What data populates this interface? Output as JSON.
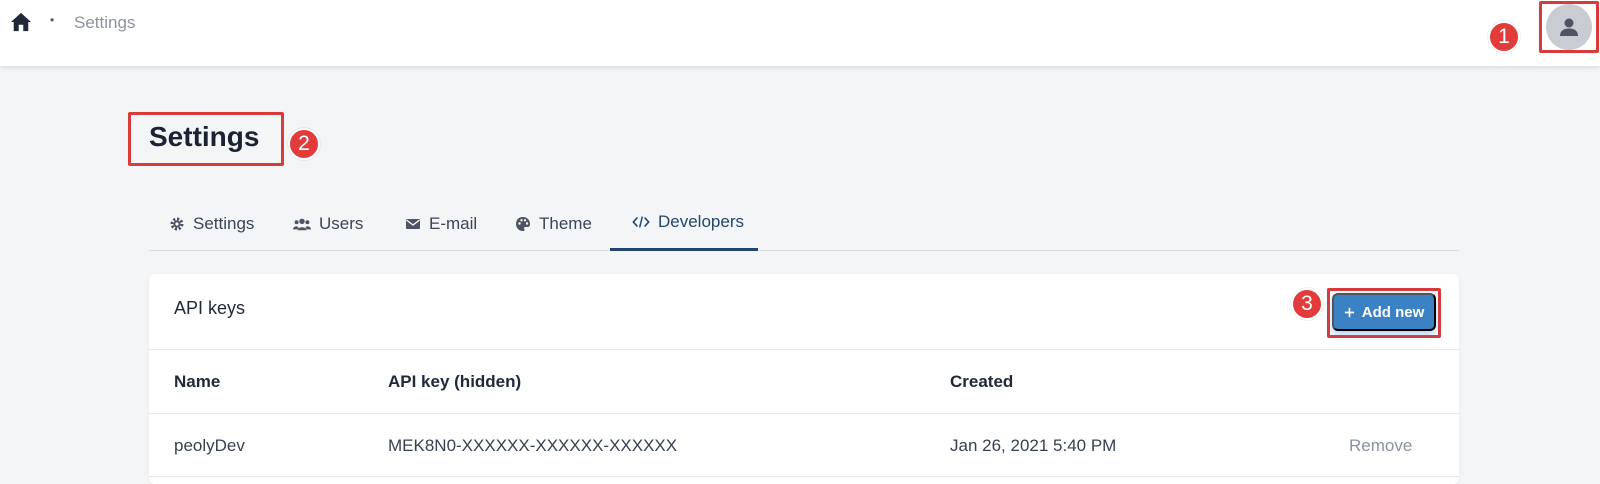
{
  "breadcrumb": {
    "separator": "•",
    "current": "Settings"
  },
  "page": {
    "title": "Settings"
  },
  "annotations": [
    "1",
    "2",
    "3"
  ],
  "tabs": [
    {
      "label": "Settings",
      "icon": "gear-icon"
    },
    {
      "label": "Users",
      "icon": "users-icon"
    },
    {
      "label": "E-mail",
      "icon": "envelope-icon"
    },
    {
      "label": "Theme",
      "icon": "palette-icon"
    },
    {
      "label": "Developers",
      "icon": "code-icon",
      "active": true
    }
  ],
  "api_keys": {
    "title": "API keys",
    "add_button": "Add new",
    "columns": [
      "Name",
      "API key (hidden)",
      "Created"
    ],
    "rows": [
      {
        "name": "peolyDev",
        "key": "MEK8N0-XXXXXX-XXXXXX-XXXXXX",
        "created": "Jan 26, 2021 5:40 PM",
        "action": "Remove"
      }
    ]
  },
  "colors": {
    "accent": "#3b82c4",
    "annotation": "#e23b3b",
    "active_tab": "#22466f"
  }
}
